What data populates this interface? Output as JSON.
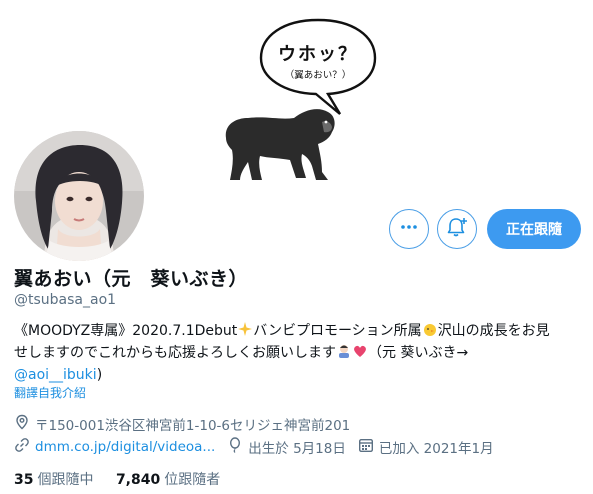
{
  "banner": {
    "bubble_main": "ウホッ？",
    "bubble_sub": "（翼あおい？）"
  },
  "actions": {
    "more_icon": "more-horizontal-icon",
    "bell_icon": "notification-bell-plus-icon",
    "follow_label": "正在跟隨"
  },
  "profile": {
    "name": "翼あおい（元　葵いぶき）",
    "handle": "@tsubasa_ao1",
    "bio_line1": "《MOODYZ専属》2020.7.1Debut",
    "bio_line1b": "バンビプロモーション所属",
    "bio_line1c": "沢山の成長をお見",
    "bio_line2": "せしますのでこれからも応援よろしくお願いします",
    "bio_line2b": "（元 葵いぶき→",
    "bio_mention": "@aoi__ibuki",
    "bio_close": ")",
    "translate": "翻譯自我介紹"
  },
  "meta": {
    "location": "〒150-001渋谷区神宮前1-10-6セリジェ神宮前201",
    "website": "dmm.co.jp/digital/videoa...",
    "birthday": "出生於 5月18日",
    "joined": "已加入 2021年1月"
  },
  "stats": {
    "following_count": "35",
    "following_label": "個跟隨中",
    "followers_count": "7,840",
    "followers_label": "位跟隨者"
  },
  "colors": {
    "accent": "#1d8fe0",
    "follow_bg": "#3d9af0",
    "muted": "#5b7083"
  }
}
